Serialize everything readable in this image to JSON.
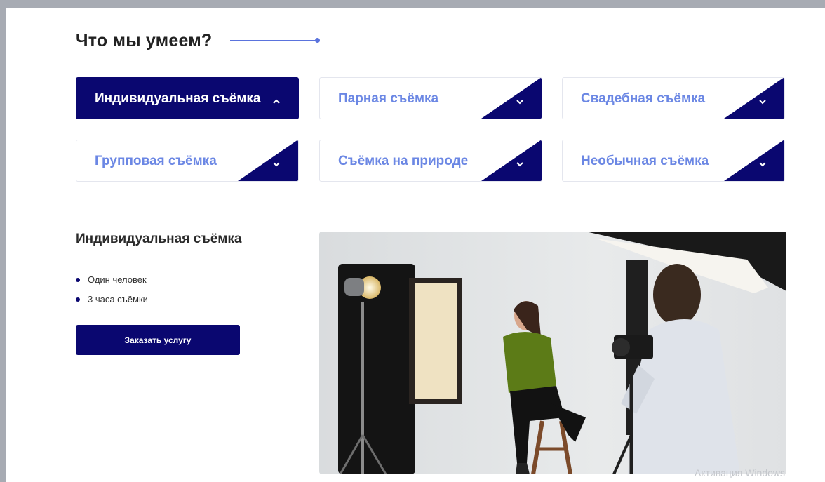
{
  "section": {
    "title": "Что мы умеем?"
  },
  "tabs": [
    {
      "label": "Индивидуальная съёмка",
      "active": true
    },
    {
      "label": "Парная съёмка",
      "active": false
    },
    {
      "label": "Свадебная съёмка",
      "active": false
    },
    {
      "label": "Групповая съёмка",
      "active": false
    },
    {
      "label": "Съёмка на природе",
      "active": false
    },
    {
      "label": "Необычная съёмка",
      "active": false
    }
  ],
  "detail": {
    "title": "Индивидуальная съёмка",
    "features": [
      "Один человек",
      "3 часа съёмки"
    ],
    "order_button": "Заказать услугу",
    "image_alt": "photo-studio-photographer-shooting-woman"
  },
  "os_watermark": "Активация Windows",
  "colors": {
    "primary": "#0a0770",
    "accent": "#6b87e4",
    "line": "#5a73dd",
    "frame": "#a7abb3"
  },
  "icons": {
    "collapse": "chevron-up-icon",
    "expand": "chevron-down-icon",
    "bullet": "dot-icon"
  }
}
